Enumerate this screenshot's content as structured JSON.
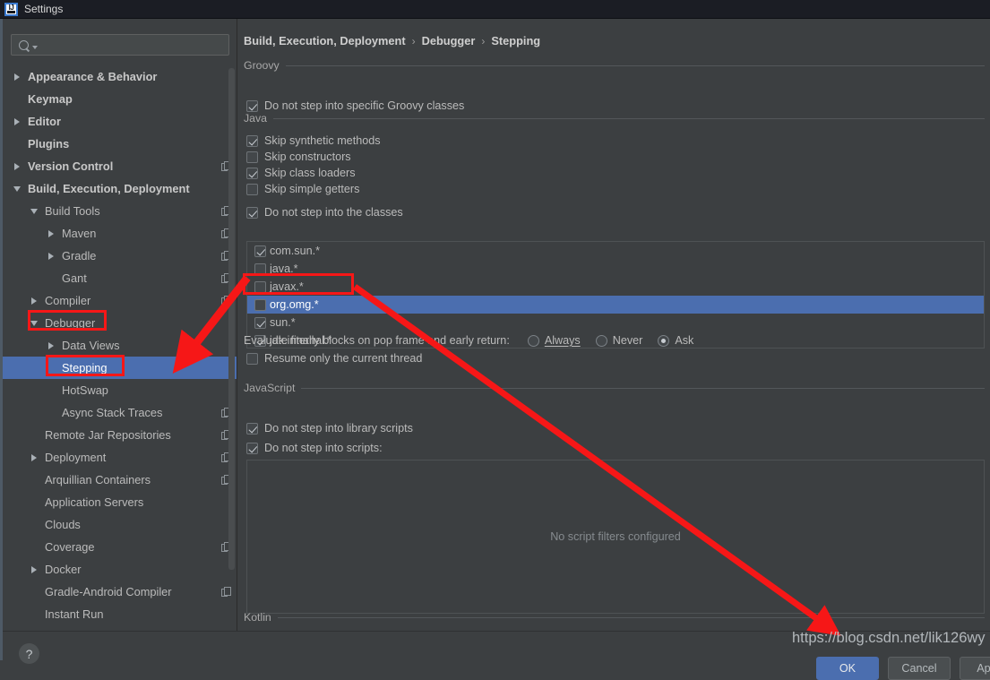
{
  "window": {
    "title": "Settings",
    "icon": "intellij-idea-icon"
  },
  "sidebar": {
    "search": {
      "value": "",
      "placeholder": "",
      "icon": "search-icon"
    },
    "items": [
      {
        "label": "Appearance & Behavior",
        "indent": 0,
        "twisty": "right",
        "bold": true,
        "sheet": false,
        "selected": false
      },
      {
        "label": "Keymap",
        "indent": 0,
        "twisty": "none",
        "bold": true,
        "sheet": false,
        "selected": false
      },
      {
        "label": "Editor",
        "indent": 0,
        "twisty": "right",
        "bold": true,
        "sheet": false,
        "selected": false
      },
      {
        "label": "Plugins",
        "indent": 0,
        "twisty": "none",
        "bold": true,
        "sheet": false,
        "selected": false
      },
      {
        "label": "Version Control",
        "indent": 0,
        "twisty": "right",
        "bold": true,
        "sheet": true,
        "selected": false
      },
      {
        "label": "Build, Execution, Deployment",
        "indent": 0,
        "twisty": "down",
        "bold": true,
        "sheet": false,
        "selected": false
      },
      {
        "label": "Build Tools",
        "indent": 1,
        "twisty": "down",
        "bold": false,
        "sheet": true,
        "selected": false
      },
      {
        "label": "Maven",
        "indent": 2,
        "twisty": "right",
        "bold": false,
        "sheet": true,
        "selected": false
      },
      {
        "label": "Gradle",
        "indent": 2,
        "twisty": "right",
        "bold": false,
        "sheet": true,
        "selected": false
      },
      {
        "label": "Gant",
        "indent": 2,
        "twisty": "none",
        "bold": false,
        "sheet": true,
        "selected": false
      },
      {
        "label": "Compiler",
        "indent": 1,
        "twisty": "right",
        "bold": false,
        "sheet": true,
        "selected": false
      },
      {
        "label": "Debugger",
        "indent": 1,
        "twisty": "down",
        "bold": false,
        "sheet": false,
        "selected": false
      },
      {
        "label": "Data Views",
        "indent": 2,
        "twisty": "right",
        "bold": false,
        "sheet": false,
        "selected": false
      },
      {
        "label": "Stepping",
        "indent": 2,
        "twisty": "none",
        "bold": false,
        "sheet": false,
        "selected": true
      },
      {
        "label": "HotSwap",
        "indent": 2,
        "twisty": "none",
        "bold": false,
        "sheet": false,
        "selected": false
      },
      {
        "label": "Async Stack Traces",
        "indent": 2,
        "twisty": "none",
        "bold": false,
        "sheet": true,
        "selected": false
      },
      {
        "label": "Remote Jar Repositories",
        "indent": 1,
        "twisty": "none",
        "bold": false,
        "sheet": true,
        "selected": false
      },
      {
        "label": "Deployment",
        "indent": 1,
        "twisty": "right",
        "bold": false,
        "sheet": true,
        "selected": false
      },
      {
        "label": "Arquillian Containers",
        "indent": 1,
        "twisty": "none",
        "bold": false,
        "sheet": true,
        "selected": false
      },
      {
        "label": "Application Servers",
        "indent": 1,
        "twisty": "none",
        "bold": false,
        "sheet": false,
        "selected": false
      },
      {
        "label": "Clouds",
        "indent": 1,
        "twisty": "none",
        "bold": false,
        "sheet": false,
        "selected": false
      },
      {
        "label": "Coverage",
        "indent": 1,
        "twisty": "none",
        "bold": false,
        "sheet": true,
        "selected": false
      },
      {
        "label": "Docker",
        "indent": 1,
        "twisty": "right",
        "bold": false,
        "sheet": false,
        "selected": false
      },
      {
        "label": "Gradle-Android Compiler",
        "indent": 1,
        "twisty": "none",
        "bold": false,
        "sheet": true,
        "selected": false
      },
      {
        "label": "Instant Run",
        "indent": 1,
        "twisty": "none",
        "bold": false,
        "sheet": false,
        "selected": false
      }
    ]
  },
  "breadcrumb": [
    "Build, Execution, Deployment",
    "Debugger",
    "Stepping"
  ],
  "main": {
    "groups": {
      "groovy": "Groovy",
      "java": "Java",
      "javascript": "JavaScript",
      "kotlin": "Kotlin"
    },
    "groovy": {
      "do_not_step_label": "Do not step into specific Groovy classes",
      "do_not_step_checked": true
    },
    "java": {
      "skip_synthetic": {
        "label": "Skip synthetic methods",
        "checked": true
      },
      "skip_constructors": {
        "label": "Skip constructors",
        "checked": false
      },
      "skip_class_loaders": {
        "label": "Skip class loaders",
        "checked": true
      },
      "skip_simple_getters": {
        "label": "Skip simple getters",
        "checked": false
      },
      "do_not_step_classes": {
        "label": "Do not step into the classes",
        "checked": true
      },
      "class_filters": [
        {
          "pattern": "com.sun.*",
          "checked": true,
          "selected": false
        },
        {
          "pattern": "java.*",
          "checked": false,
          "selected": false
        },
        {
          "pattern": "javax.*",
          "checked": false,
          "selected": false
        },
        {
          "pattern": "org.omg.*",
          "checked": false,
          "selected": true
        },
        {
          "pattern": "sun.*",
          "checked": true,
          "selected": false
        },
        {
          "pattern": "jdk.internal.*",
          "checked": true,
          "selected": false
        }
      ],
      "evaluate_finally_label": "Evaluate finally blocks on pop frame and early return:",
      "evaluate_finally_options": [
        {
          "label": "Always",
          "selected": false
        },
        {
          "label": "Never",
          "selected": false
        },
        {
          "label": "Ask",
          "selected": true
        }
      ],
      "resume_only_current_thread": {
        "label": "Resume only the current thread",
        "checked": false
      }
    },
    "javascript": {
      "do_not_step_library": {
        "label": "Do not step into library scripts",
        "checked": true
      },
      "do_not_step_scripts": {
        "label": "Do not step into scripts:",
        "checked": true
      },
      "empty_filters_text": "No script filters configured"
    }
  },
  "footer": {
    "help_label": "?",
    "ok_label": "OK",
    "cancel_label": "Cancel",
    "apply_label": "Apply"
  },
  "annotation": {
    "watermark": "https://blog.csdn.net/lik126wy",
    "highlight_color": "#f61717",
    "accent_color": "#4b6eaf"
  }
}
